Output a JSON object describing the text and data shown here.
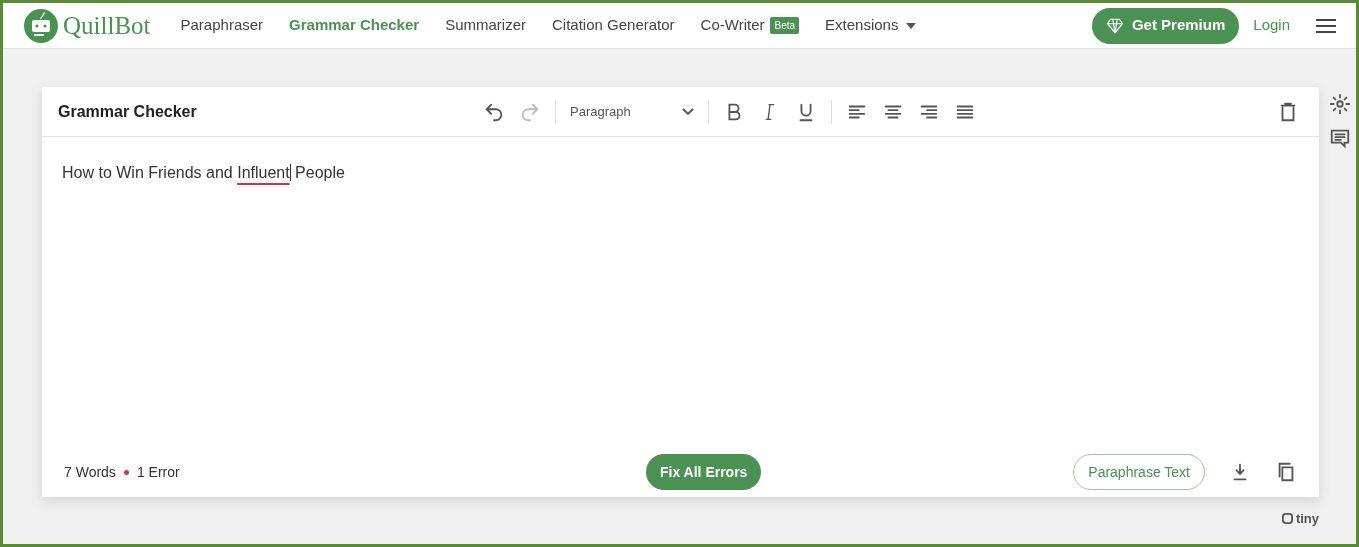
{
  "brand": "QuillBot",
  "nav": [
    {
      "label": "Paraphraser",
      "selected": false
    },
    {
      "label": "Grammar Checker",
      "selected": true
    },
    {
      "label": "Summarizer",
      "selected": false
    },
    {
      "label": "Citation Generator",
      "selected": false
    },
    {
      "label": "Co-Writer",
      "selected": false,
      "badge": "Beta"
    },
    {
      "label": "Extensions",
      "selected": false,
      "dropdown": true
    }
  ],
  "premium_button": "Get Premium",
  "login_link": "Login",
  "editor": {
    "title": "Grammar Checker",
    "undo_disabled": false,
    "redo_disabled": true,
    "block_format": "Paragraph",
    "segments": [
      {
        "text": "How to Win Friends and ",
        "error": false
      },
      {
        "text": "Influent",
        "error": true
      },
      {
        "text": " People",
        "error": false
      }
    ],
    "word_count": "7 Words",
    "error_count": "1 Error",
    "fix_button": "Fix All Errors",
    "paraphrase_button": "Paraphrase Text"
  },
  "powered_by": "tiny"
}
